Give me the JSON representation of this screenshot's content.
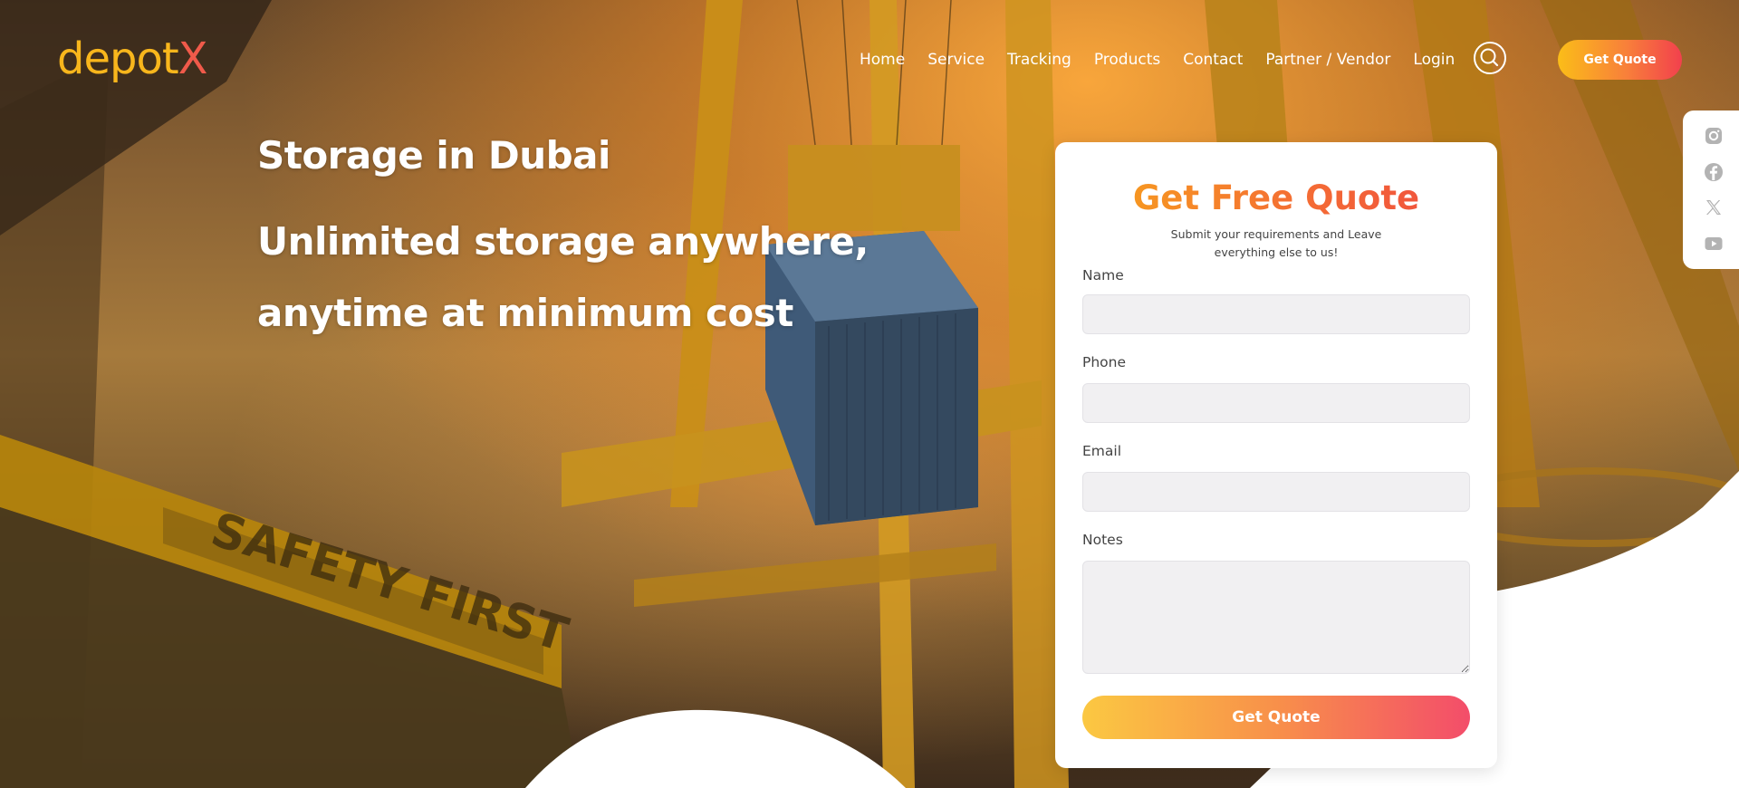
{
  "brand": {
    "logo_part1": "dep",
    "logo_part2": "ot",
    "logo_part3": "X",
    "colors": {
      "primary": "#f8b61c",
      "accent": "#f05a4a"
    }
  },
  "nav": {
    "items": [
      "Home",
      "Service",
      "Tracking",
      "Products",
      "Contact",
      "Partner / Vendor",
      "Login"
    ],
    "search_icon": "search-icon",
    "cta_label": "Get Quote"
  },
  "social": {
    "icons": [
      "instagram-icon",
      "facebook-icon",
      "x-twitter-icon",
      "youtube-icon"
    ]
  },
  "hero": {
    "line1": "Storage in Dubai",
    "line2": "Unlimited storage anywhere,",
    "line3": "anytime at minimum cost",
    "background": "cargo port crane lifting container at sunset, Safety First signage"
  },
  "quote_form": {
    "title": "Get Free Quote",
    "subtitle": "Submit your requirements and Leave everything else to us!",
    "fields": {
      "name": {
        "label": "Name",
        "value": "",
        "placeholder": ""
      },
      "phone": {
        "label": "Phone",
        "value": "",
        "placeholder": ""
      },
      "email": {
        "label": "Email",
        "value": "",
        "placeholder": ""
      },
      "notes": {
        "label": "Notes",
        "value": "",
        "placeholder": ""
      }
    },
    "submit_label": "Get Quote"
  }
}
